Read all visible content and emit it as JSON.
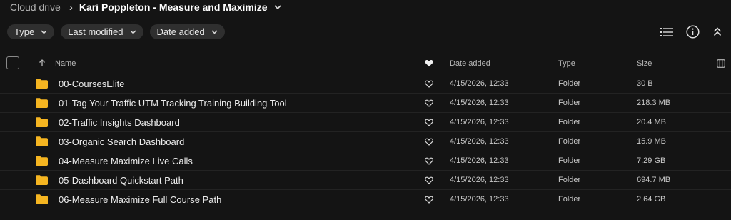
{
  "breadcrumb": {
    "root": "Cloud drive",
    "separator": "›",
    "current": "Kari Poppleton - Measure and Maximize"
  },
  "filters": [
    {
      "label": "Type"
    },
    {
      "label": "Last modified"
    },
    {
      "label": "Date added"
    }
  ],
  "toolbar": {
    "icons": [
      "list-view-icon",
      "info-icon",
      "collapse-icon"
    ]
  },
  "table": {
    "columns": {
      "name": "Name",
      "date_added": "Date added",
      "type": "Type",
      "size": "Size"
    },
    "rows": [
      {
        "name": "00-CoursesElite",
        "date_added": "4/15/2026, 12:33",
        "type": "Folder",
        "size": "30 B"
      },
      {
        "name": "01-Tag Your Traffic UTM Tracking Training Building Tool",
        "date_added": "4/15/2026, 12:33",
        "type": "Folder",
        "size": "218.3 MB"
      },
      {
        "name": "02-Traffic Insights Dashboard",
        "date_added": "4/15/2026, 12:33",
        "type": "Folder",
        "size": "20.4 MB"
      },
      {
        "name": "03-Organic Search Dashboard",
        "date_added": "4/15/2026, 12:33",
        "type": "Folder",
        "size": "15.9 MB"
      },
      {
        "name": "04-Measure Maximize Live Calls",
        "date_added": "4/15/2026, 12:33",
        "type": "Folder",
        "size": "7.29 GB"
      },
      {
        "name": "05-Dashboard Quickstart Path",
        "date_added": "4/15/2026, 12:33",
        "type": "Folder",
        "size": "694.7 MB"
      },
      {
        "name": "06-Measure Maximize Full Course Path",
        "date_added": "4/15/2026, 12:33",
        "type": "Folder",
        "size": "2.64 GB"
      }
    ]
  },
  "colors": {
    "background": "#141414",
    "chip": "#2f2f2f",
    "folder": "#f5b521",
    "text": "#e6e6e6",
    "muted": "#b8b8b8"
  }
}
